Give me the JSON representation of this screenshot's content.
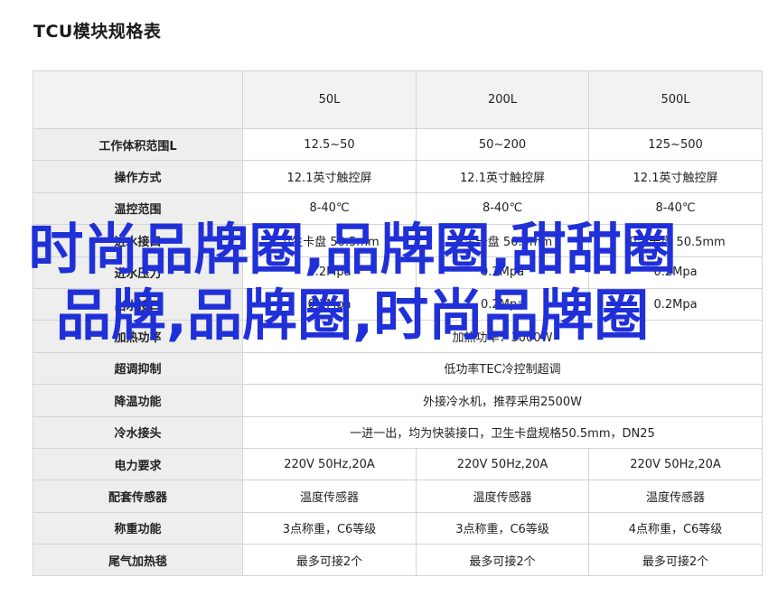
{
  "title": "TCU模块规格表",
  "table": {
    "corner": "",
    "columns": [
      "50L",
      "200L",
      "500L"
    ],
    "rows": [
      {
        "label": "工作体积范围L",
        "cells": [
          "12.5~50",
          "50~200",
          "125~500"
        ]
      },
      {
        "label": "操作方式",
        "cells": [
          "12.1英寸触控屏",
          "12.1英寸触控屏",
          "12.1英寸触控屏"
        ]
      },
      {
        "label": "温控范围",
        "cells": [
          "8-40℃",
          "8-40℃",
          "8-40℃"
        ]
      },
      {
        "label": "进水接口",
        "cells": [
          "卫生卡盘 50.5mm",
          "卫生卡盘 50.5mm",
          "卫生卡盘 50.5mm"
        ]
      },
      {
        "label": "进水压力",
        "cells": [
          "0.2Mpa",
          "0.2Mpa",
          "0.2Mpa"
        ]
      },
      {
        "label": "出水接口",
        "cells": [
          "0.2Mpa",
          "0.2Mpa",
          "0.2Mpa"
        ]
      },
      {
        "label": "加热功率",
        "span": "加热功率：3000W"
      },
      {
        "label": "超调抑制",
        "span": "低功率TEC冷控制超调"
      },
      {
        "label": "降温功能",
        "span": "外接冷水机，推荐采用2500W"
      },
      {
        "label": "冷水接头",
        "span": "一进一出，均为快装接口，卫生卡盘规格50.5mm，DN25"
      },
      {
        "label": "电力要求",
        "cells": [
          "220V 50Hz,20A",
          "220V 50Hz,20A",
          "220V 50Hz,20A"
        ]
      },
      {
        "label": "配套传感器",
        "cells": [
          "温度传感器",
          "温度传感器",
          "温度传感器"
        ]
      },
      {
        "label": "称重功能",
        "cells": [
          "3点称重，C6等级",
          "3点称重，C6等级",
          "4点称重，C6等级"
        ]
      },
      {
        "label": "尾气加热毯",
        "cells": [
          "最多可接2个",
          "最多可接2个",
          "最多可接2个"
        ]
      }
    ]
  },
  "overlay_text": "时尚品牌圈,品牌圈,甜甜圈品牌,品牌圈,时尚品牌圈"
}
